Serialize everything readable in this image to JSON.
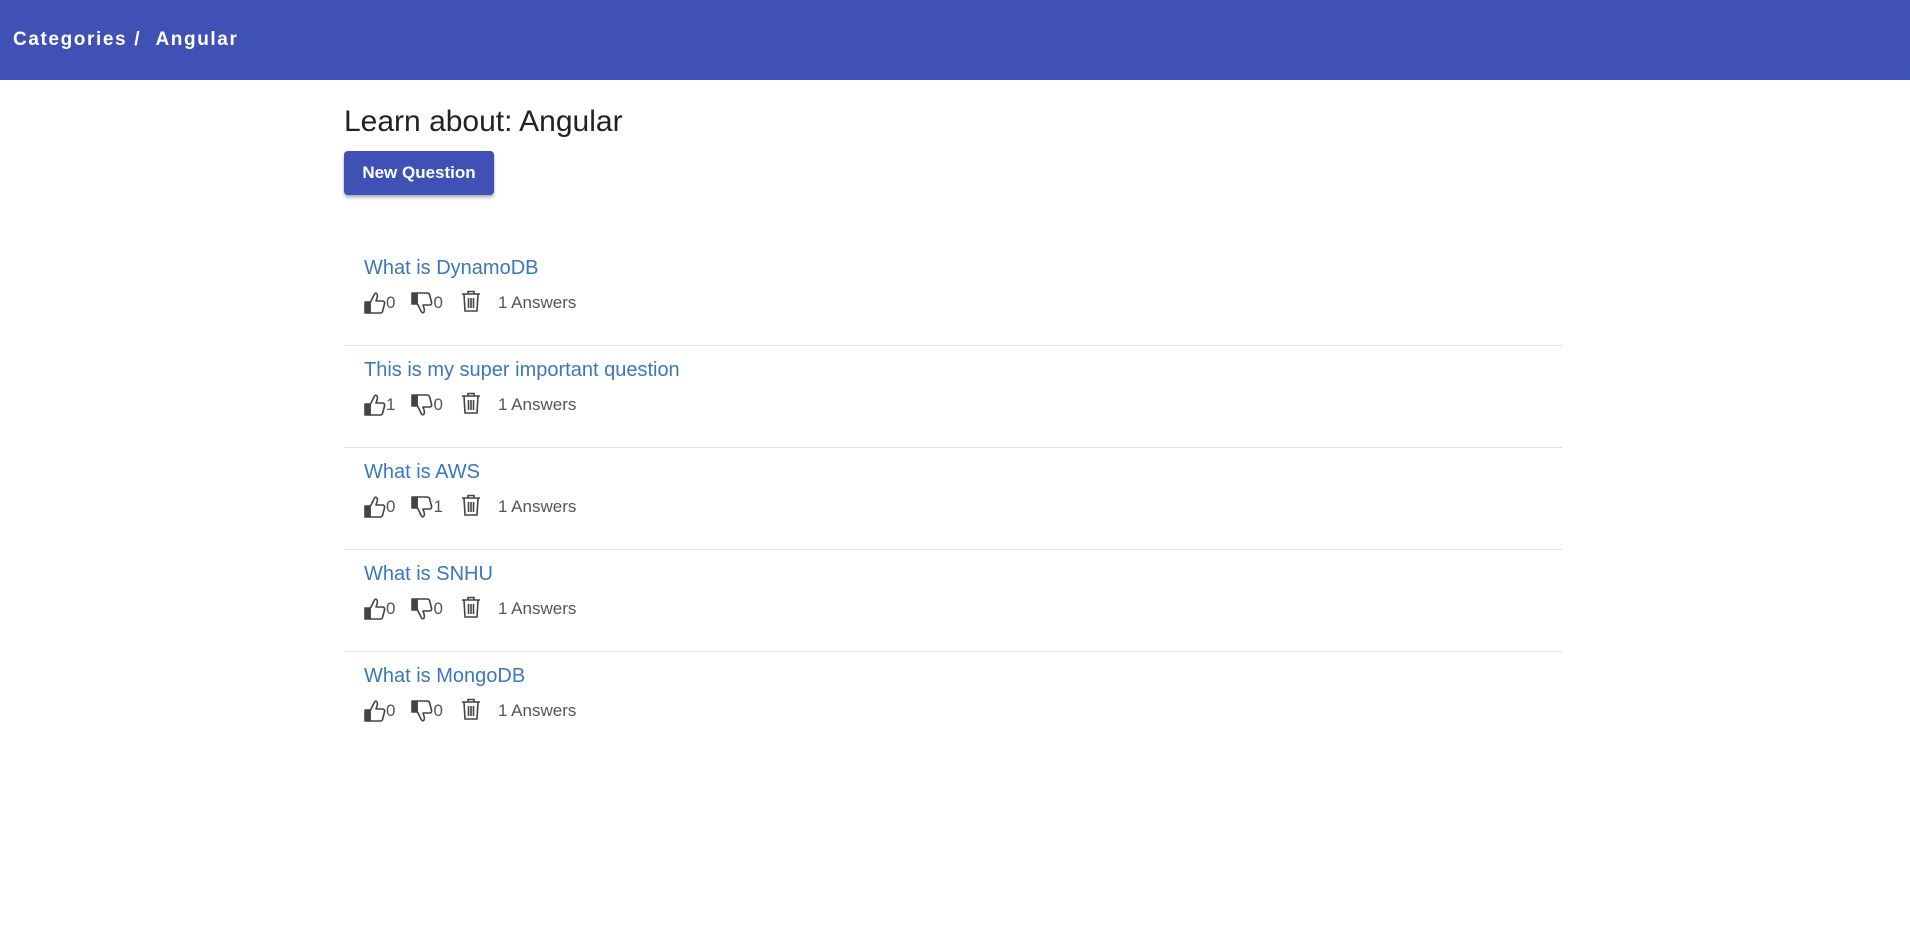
{
  "breadcrumb": {
    "root_label": "Categories",
    "separator": "/",
    "current_label": "Angular"
  },
  "page": {
    "title": "Learn about: Angular",
    "new_question_label": "New Question"
  },
  "colors": {
    "primary": "#3f51b5",
    "link": "#3a77bd"
  },
  "questions": [
    {
      "title": "What is DynamoDB",
      "upvotes": "0",
      "downvotes": "0",
      "answers": "1 Answers"
    },
    {
      "title": "This is my super important question",
      "upvotes": "1",
      "downvotes": "0",
      "answers": "1 Answers"
    },
    {
      "title": "What is AWS",
      "upvotes": "0",
      "downvotes": "1",
      "answers": "1 Answers"
    },
    {
      "title": "What is SNHU",
      "upvotes": "0",
      "downvotes": "0",
      "answers": "1 Answers"
    },
    {
      "title": "What is MongoDB",
      "upvotes": "0",
      "downvotes": "0",
      "answers": "1 Answers"
    }
  ],
  "icons": {
    "upvote": "thumbs-up-icon",
    "downvote": "thumbs-down-icon",
    "delete": "trash-icon"
  }
}
